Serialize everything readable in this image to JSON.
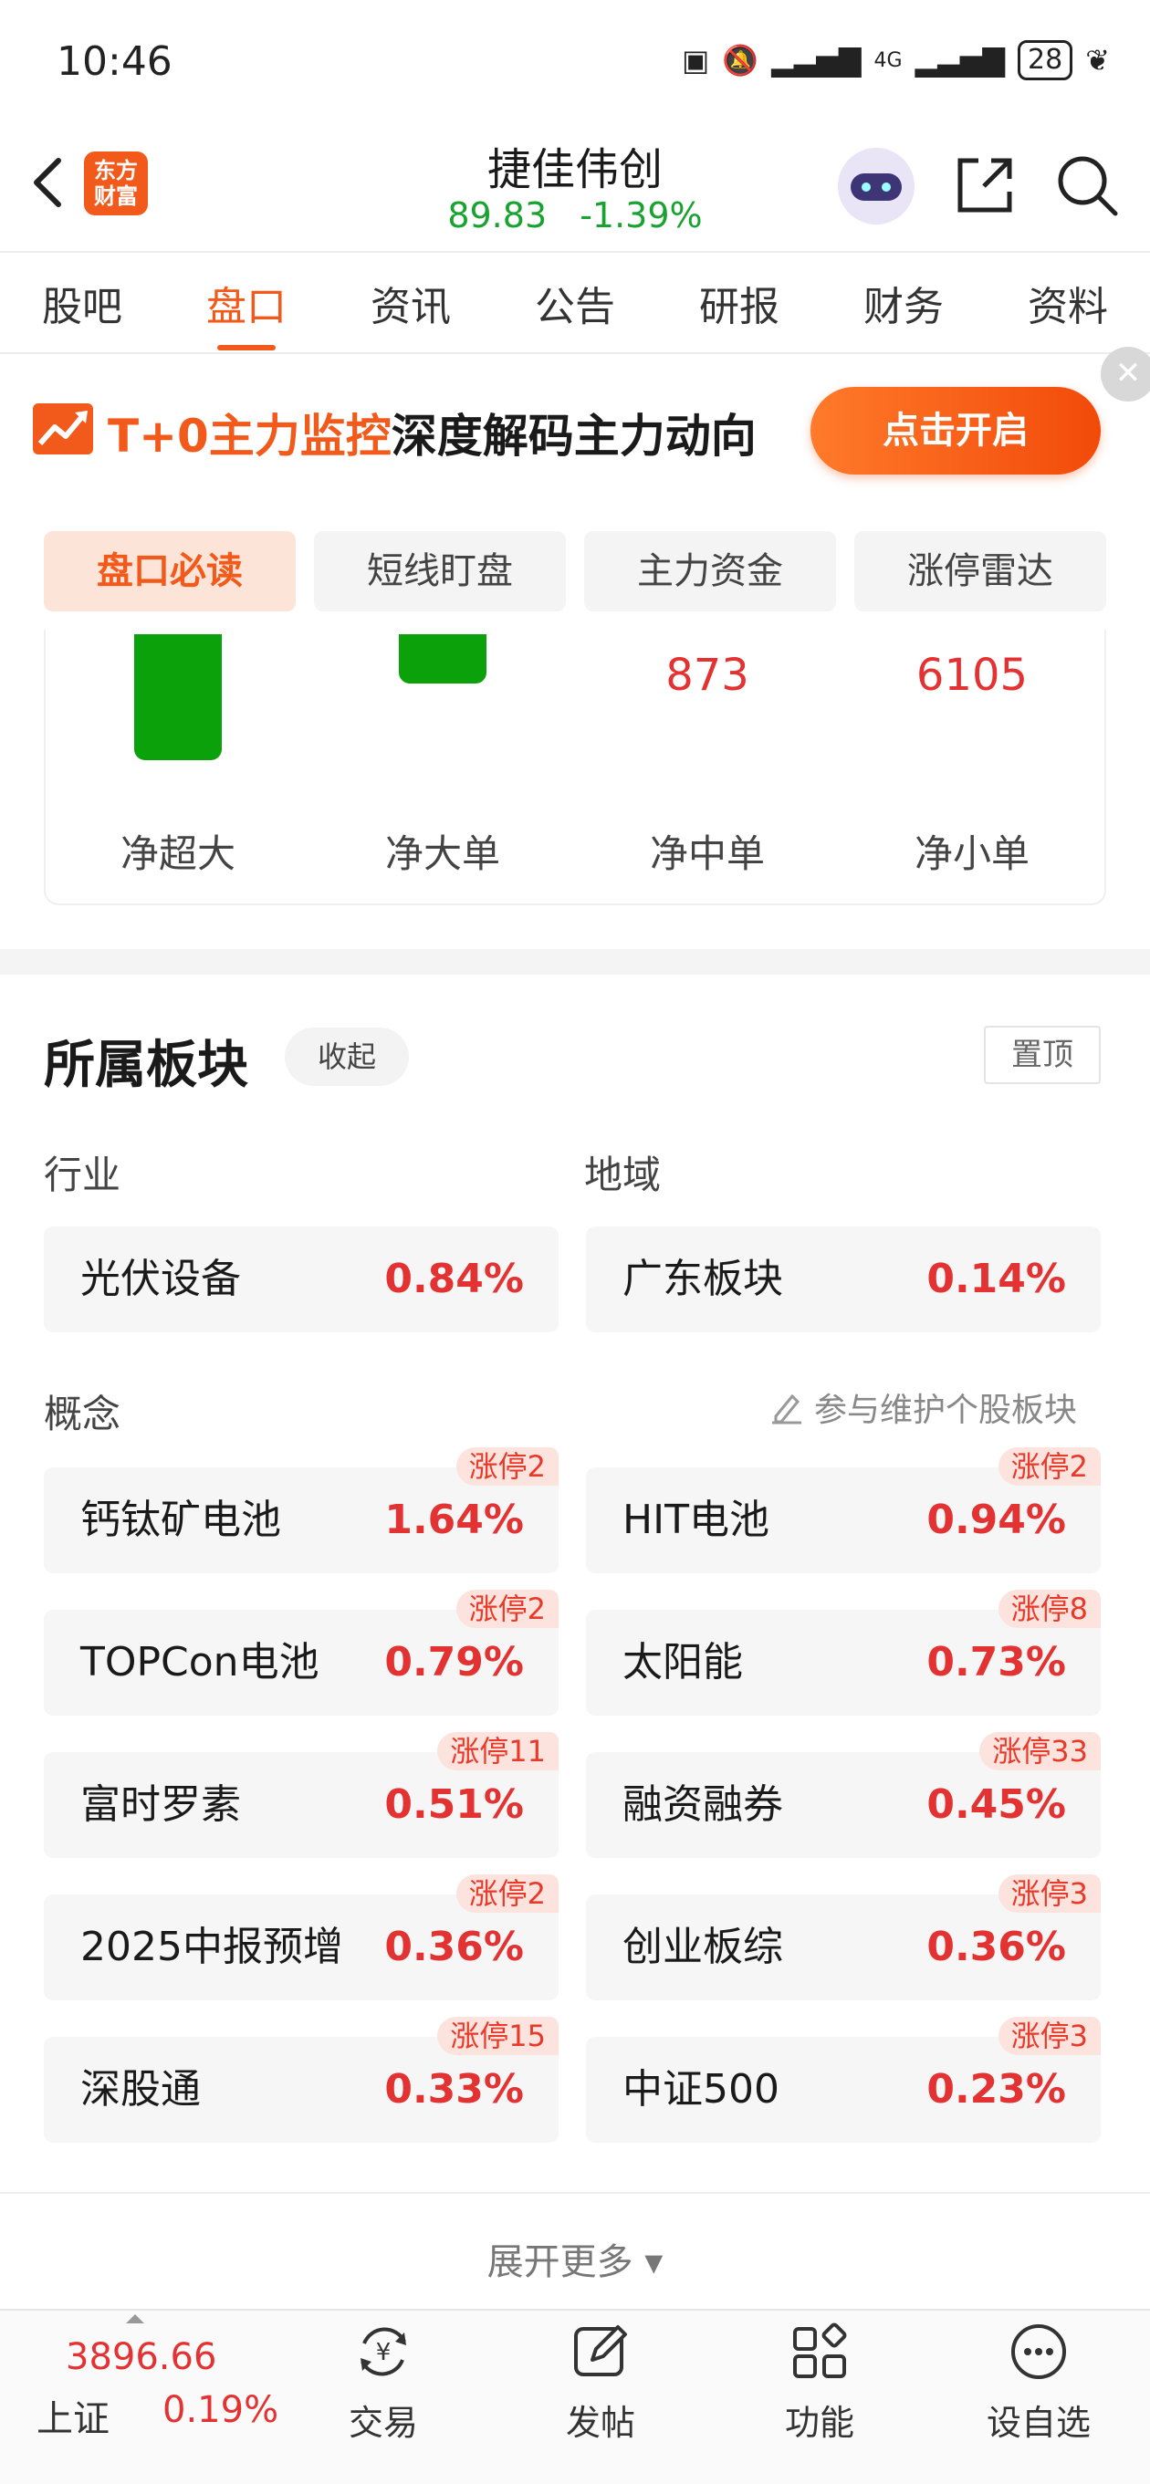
{
  "status": {
    "time": "10:46",
    "battery": "28",
    "signal_text": "4G"
  },
  "header": {
    "logo_text": "东方\n财富",
    "stock_name": "捷佳伟创",
    "price": "89.83",
    "change": "-1.39%"
  },
  "tabs": [
    {
      "label": "股吧",
      "active": false
    },
    {
      "label": "盘口",
      "active": true
    },
    {
      "label": "资讯",
      "active": false
    },
    {
      "label": "公告",
      "active": false
    },
    {
      "label": "研报",
      "active": false
    },
    {
      "label": "财务",
      "active": false
    },
    {
      "label": "资料",
      "active": false
    }
  ],
  "banner": {
    "highlight": "T+0主力监控",
    "text": "深度解码主力动向",
    "button": "点击开启"
  },
  "subtabs": [
    {
      "label": "盘口必读",
      "active": true
    },
    {
      "label": "短线盯盘",
      "active": false
    },
    {
      "label": "主力资金",
      "active": false
    },
    {
      "label": "涨停雷达",
      "active": false
    }
  ],
  "fund_flow": {
    "labels": [
      "净超大",
      "净大单",
      "净中单",
      "净小单"
    ],
    "values": [
      "",
      "",
      "873",
      "6105"
    ],
    "bar_colors": [
      "#0ba10b",
      "#0ba10b"
    ]
  },
  "sector": {
    "title": "所属板块",
    "collapse": "收起",
    "pin": "置顶",
    "industry_label": "行业",
    "region_label": "地域",
    "industry": {
      "name": "光伏设备",
      "pct": "0.84%"
    },
    "region": {
      "name": "广东板块",
      "pct": "0.14%"
    },
    "concept_label": "概念",
    "maintain_text": "参与维护个股板块",
    "concepts": [
      {
        "name": "钙钛矿电池",
        "pct": "1.64%",
        "badge": "涨停2"
      },
      {
        "name": "HIT电池",
        "pct": "0.94%",
        "badge": "涨停2"
      },
      {
        "name": "TOPCon电池",
        "pct": "0.79%",
        "badge": "涨停2"
      },
      {
        "name": "太阳能",
        "pct": "0.73%",
        "badge": "涨停8"
      },
      {
        "name": "富时罗素",
        "pct": "0.51%",
        "badge": "涨停11"
      },
      {
        "name": "融资融券",
        "pct": "0.45%",
        "badge": "涨停33"
      },
      {
        "name": "2025中报预增",
        "pct": "0.36%",
        "badge": "涨停2"
      },
      {
        "name": "创业板综",
        "pct": "0.36%",
        "badge": "涨停3"
      },
      {
        "name": "深股通",
        "pct": "0.33%",
        "badge": "涨停15"
      },
      {
        "name": "中证500",
        "pct": "0.23%",
        "badge": "涨停3"
      }
    ],
    "expand": "展开更多 ▾"
  },
  "bottom": {
    "index_value": "3896.66",
    "index_name": "上证",
    "index_pct": "0.19%",
    "nav": [
      {
        "label": "交易",
        "icon": "trade-icon"
      },
      {
        "label": "发帖",
        "icon": "post-icon"
      },
      {
        "label": "功能",
        "icon": "grid-icon"
      },
      {
        "label": "设自选",
        "icon": "more-icon"
      }
    ]
  }
}
